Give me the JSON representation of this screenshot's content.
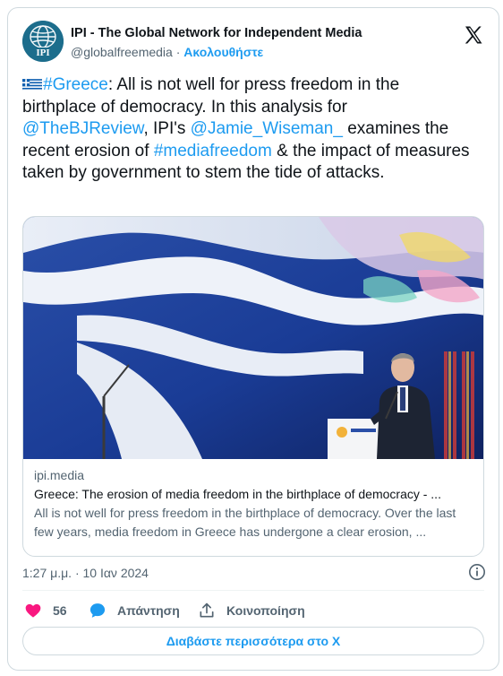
{
  "author": {
    "name": "IPI - The Global Network for Independent Media",
    "handle": "@globalfreemedia",
    "separator": " · ",
    "follow_label": "Ακολουθήστε",
    "avatar_text": "IPI"
  },
  "tweet": {
    "seg1": "#Greece",
    "seg2": ": All is not well for press freedom in the birthplace of democracy. In this analysis for ",
    "seg3": "@TheBJReview",
    "seg4": ", IPI's ",
    "seg5": "@Jamie_Wiseman_",
    "seg6": " examines the recent erosion of ",
    "seg7": "#mediafreedom",
    "seg8": " & the impact of measures taken by government to stem the tide of attacks."
  },
  "card": {
    "domain": "ipi.media",
    "title": "Greece: The erosion of media freedom in the birthplace of democracy - ...",
    "description": "All is not well for press freedom in the birthplace of democracy. Over the last few years, media freedom in Greece has undergone a clear erosion, ..."
  },
  "timestamp": "1:27 μ.μ. · 10 Ιαν 2024",
  "actions": {
    "like_count": "56",
    "reply_label": "Απάντηση",
    "share_label": "Κοινοποίηση"
  },
  "read_more_label": "Διαβάστε περισσότερα στο X",
  "colors": {
    "link": "#1d9bf0",
    "like": "#f91880",
    "secondary_text": "#536471",
    "border": "#cfd9de",
    "flag_blue": "#0d5eaf"
  },
  "icons": [
    "greece-flag-icon",
    "x-logo-icon",
    "info-icon",
    "heart-icon",
    "reply-bubble-icon",
    "share-icon"
  ]
}
